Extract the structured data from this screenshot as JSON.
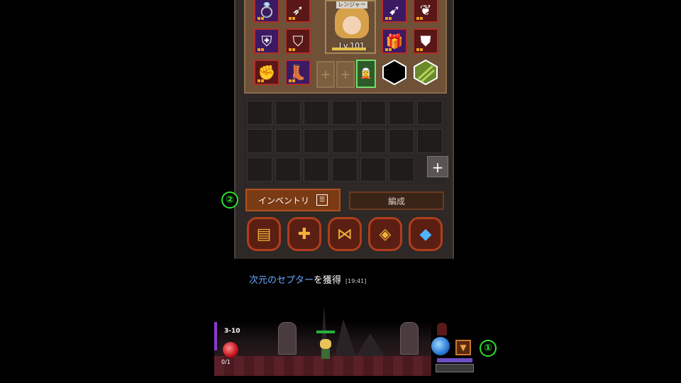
{
  "equipment": {
    "character_tag": "レンジャー",
    "level_text": "Lv.101",
    "exp_progress": 0.85,
    "slots": [
      {
        "icon": "ring-icon",
        "rarity": "purple"
      },
      {
        "icon": "arrow-icon",
        "rarity": "red"
      },
      {
        "icon": "bow-icon",
        "rarity": "purple"
      },
      {
        "icon": "amulet-icon",
        "rarity": "red"
      },
      {
        "icon": "shoulder-armor-icon",
        "rarity": "purple"
      },
      {
        "icon": "chest-armor-icon",
        "rarity": "red"
      },
      {
        "icon": "gift-box-icon",
        "rarity": "purple"
      },
      {
        "icon": "shield-icon",
        "rarity": "red"
      },
      {
        "icon": "gauntlet-icon",
        "rarity": "red"
      },
      {
        "icon": "boots-icon",
        "rarity": "purple"
      }
    ],
    "empty_slot_glyph": "+",
    "hex_slots": [
      "dark-hex-icon",
      "green-hex-icon"
    ]
  },
  "inventory": {
    "add_label": "+"
  },
  "tabs": {
    "inventory_label": "インベントリ",
    "formation_label": "編成"
  },
  "action_buttons": [
    {
      "name": "treasure-chest-icon",
      "glyph": "▤"
    },
    {
      "name": "cross-icon",
      "glyph": "✚"
    },
    {
      "name": "rune-icon",
      "glyph": "⋈"
    },
    {
      "name": "cube-icon",
      "glyph": "◈"
    },
    {
      "name": "crystal-icon",
      "glyph": "◆"
    }
  ],
  "callouts": {
    "tab_marker": "②",
    "scene_marker": "①"
  },
  "log": {
    "item_name": "次元のセプター",
    "message_suffix": "を獲得",
    "time": "[19:41]"
  },
  "scene": {
    "stage": "3-10",
    "gem_count": "0/1"
  },
  "colors": {
    "highlight_green": "#2de02d",
    "log_item_blue": "#6aa8ff",
    "tab_active": "#7a3a14"
  }
}
